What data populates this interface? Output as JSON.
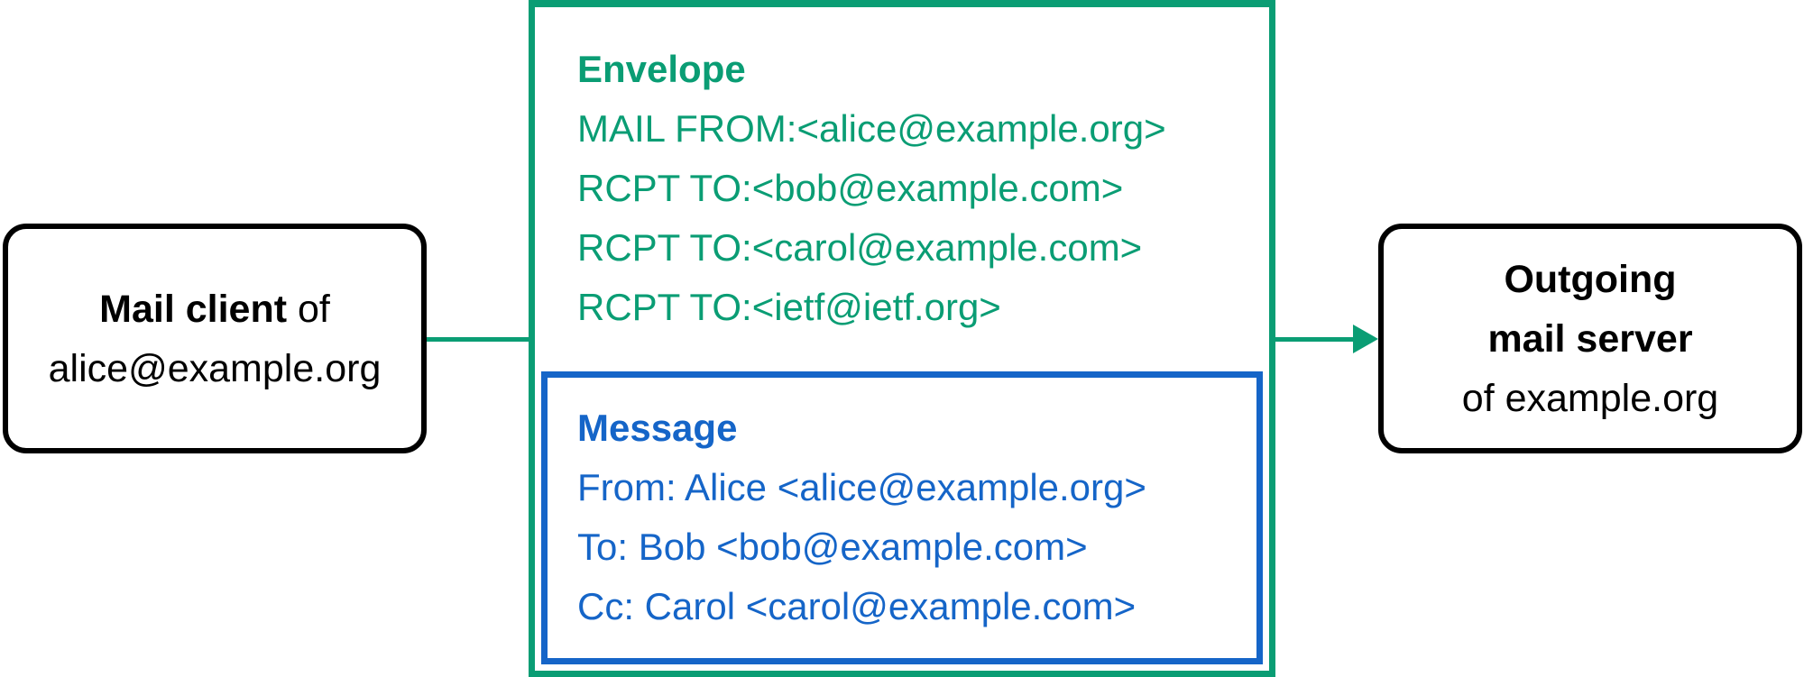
{
  "colors": {
    "envelope": "#0a9d74",
    "message": "#1565c8",
    "node_border": "#000000"
  },
  "client": {
    "bold_text": "Mail client",
    "text_suffix": " of",
    "address": "alice@example.org"
  },
  "envelope": {
    "heading": "Envelope",
    "lines": [
      "MAIL FROM:<alice@example.org>",
      "RCPT TO:<bob@example.com>",
      "RCPT TO:<carol@example.com>",
      "RCPT TO:<ietf@ietf.org>"
    ]
  },
  "message": {
    "heading": "Message",
    "lines": [
      "From: Alice <alice@example.org>",
      "To: Bob <bob@example.com>",
      "Cc: Carol <carol@example.com>"
    ]
  },
  "server": {
    "bold_line1": "Outgoing",
    "bold_line2": "mail server",
    "line3": "of example.org"
  }
}
